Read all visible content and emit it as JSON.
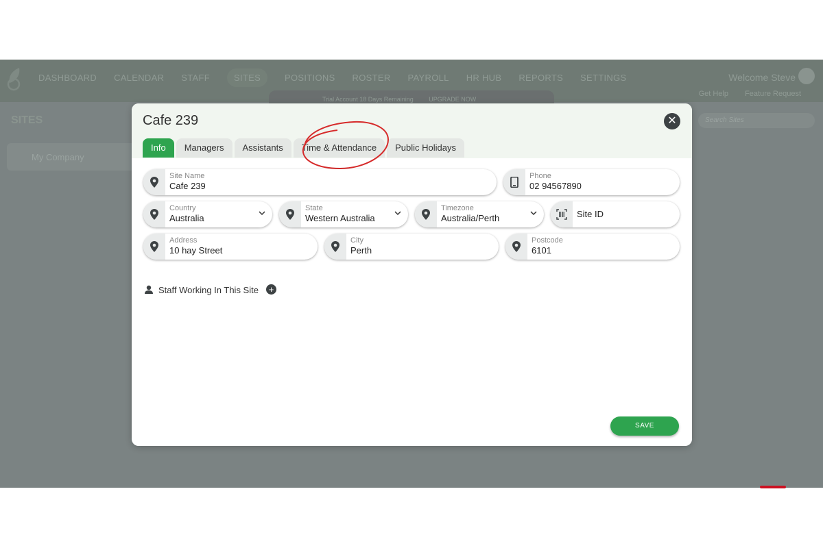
{
  "app": {
    "nav": [
      "DASHBOARD",
      "CALENDAR",
      "STAFF",
      "SITES",
      "POSITIONS",
      "ROSTER",
      "PAYROLL",
      "HR HUB",
      "REPORTS",
      "SETTINGS"
    ],
    "welcome": "Welcome Steve",
    "get_help": "Get Help",
    "feature_request": "Feature Request",
    "trial": "Trial Account 18 Days Remaining",
    "upgrade": "UPGRADE NOW",
    "sites_title": "SITES",
    "company": "My Company",
    "search_placeholder": "Search Sites"
  },
  "modal": {
    "title": "Cafe 239",
    "tabs": [
      "Info",
      "Managers",
      "Assistants",
      "Time & Attendance",
      "Public Holidays"
    ],
    "active_tab": "Info",
    "fields": {
      "site_name": {
        "label": "Site Name",
        "value": "Cafe 239"
      },
      "phone": {
        "label": "Phone",
        "value": "02 94567890"
      },
      "country": {
        "label": "Country",
        "value": "Australia"
      },
      "state": {
        "label": "State",
        "value": "Western Australia"
      },
      "timezone": {
        "label": "Timezone",
        "value": "Australia/Perth"
      },
      "site_id": {
        "label": "Site ID"
      },
      "address": {
        "label": "Address",
        "value": "10 hay Street"
      },
      "city": {
        "label": "City",
        "value": "Perth"
      },
      "postcode": {
        "label": "Postcode",
        "value": "6101"
      }
    },
    "staff_label": "Staff Working In This Site",
    "save": "SAVE"
  },
  "colors": {
    "accent": "#2ea44f",
    "overlay": "#7b8383",
    "annotation": "#d62a2a"
  }
}
